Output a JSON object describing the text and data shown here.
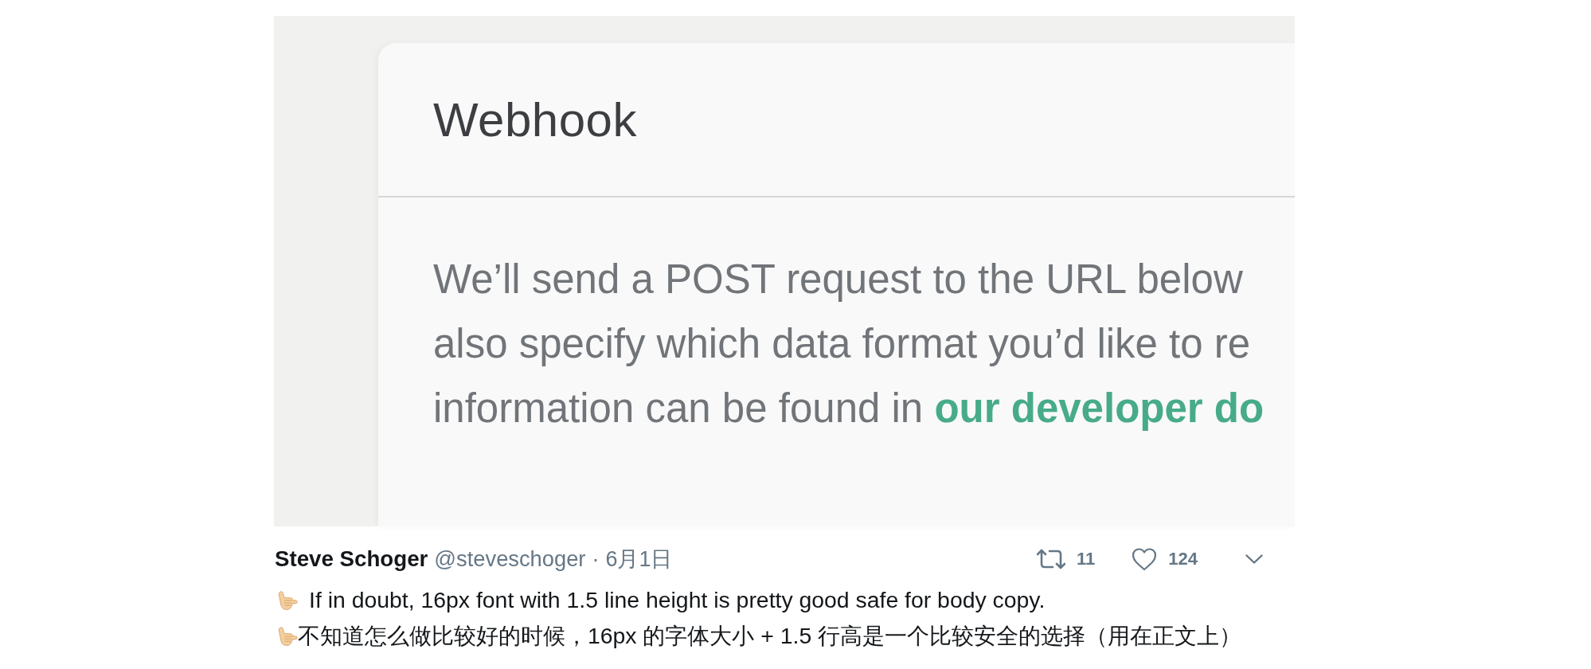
{
  "screenshot": {
    "card": {
      "title": "Webhook",
      "description": {
        "lines": [
          "We’ll send a POST request to the URL below",
          "also specify which data format you’d like to re",
          "information can be found in"
        ],
        "link": "our developer do"
      }
    }
  },
  "tweet": {
    "author": {
      "name": "Steve Schoger",
      "handle": "@steveschoger"
    },
    "separator": "·",
    "date": "6月1日",
    "actions": [
      {
        "kind": "retweet",
        "count": "11"
      },
      {
        "kind": "like",
        "count": "124"
      },
      {
        "kind": "more"
      }
    ],
    "lines": [
      {
        "text": "If in doubt, 16px font with 1.5 line height is pretty good safe for body copy.",
        "spaced": true
      },
      {
        "text": "不知道怎么做比较好的时候，16px 的字体大小 + 1.5 行高是一个比较安全的选择（用在正文上）",
        "spaced": false
      }
    ]
  }
}
